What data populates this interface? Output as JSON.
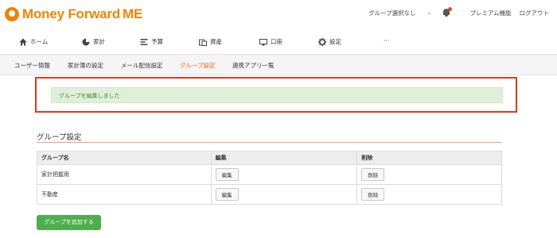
{
  "header": {
    "logo_text": "Money Forward",
    "logo_suffix": "ME",
    "group_select": "グループ選択なし",
    "premium": "プレミアム機能",
    "logout": "ログアウト",
    "brand_color": "#f08300"
  },
  "main_nav": {
    "items": [
      {
        "label": "ホーム",
        "icon": "home-icon"
      },
      {
        "label": "家計",
        "icon": "pie-chart-icon"
      },
      {
        "label": "予算",
        "icon": "budget-list-icon"
      },
      {
        "label": "資産",
        "icon": "assets-icon"
      },
      {
        "label": "口座",
        "icon": "account-icon"
      },
      {
        "label": "設定",
        "icon": "gear-icon"
      },
      {
        "label": "···",
        "icon": "more-icon"
      }
    ]
  },
  "sub_nav": {
    "items": [
      {
        "label": "ユーザー情報"
      },
      {
        "label": "家計簿の設定"
      },
      {
        "label": "メール配信設定"
      },
      {
        "label": "グループ設定"
      },
      {
        "label": "連携アプリ一覧"
      }
    ],
    "active_index": 3,
    "active_color": "#e86a1a"
  },
  "alert": {
    "message": "グループを編集しました",
    "highlight_color": "#e2361b"
  },
  "section": {
    "title": "グループ設定"
  },
  "table": {
    "headers": [
      "グループ名",
      "編集",
      "削除"
    ],
    "rows": [
      {
        "name": "家計把握用",
        "edit_label": "編集",
        "delete_label": "削除"
      },
      {
        "name": "不動産",
        "edit_label": "編集",
        "delete_label": "削除"
      }
    ]
  },
  "add_button": {
    "label": "グループを追加する",
    "color": "#4cae4c"
  }
}
